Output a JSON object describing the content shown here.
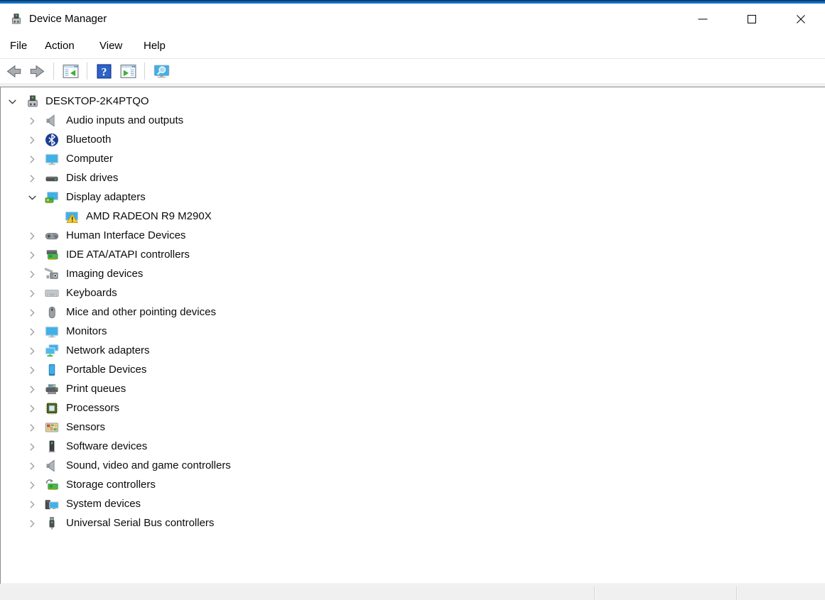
{
  "window": {
    "title": "Device Manager",
    "icon": "device-manager",
    "controls": [
      {
        "name": "minimize",
        "glyph": "minimize"
      },
      {
        "name": "maximize",
        "glyph": "maximize"
      },
      {
        "name": "close",
        "glyph": "close"
      }
    ]
  },
  "menu": {
    "items": [
      {
        "label": "File"
      },
      {
        "label": "Action"
      },
      {
        "label": "View"
      },
      {
        "label": "Help"
      }
    ]
  },
  "toolbar": {
    "buttons": [
      {
        "name": "back",
        "icon": "back-arrow"
      },
      {
        "name": "forward",
        "icon": "forward-arrow"
      },
      {
        "name": "separator"
      },
      {
        "name": "show-console-tree",
        "icon": "console-tree"
      },
      {
        "name": "separator"
      },
      {
        "name": "help",
        "icon": "help"
      },
      {
        "name": "show-action-pane",
        "icon": "action-pane"
      },
      {
        "name": "separator"
      },
      {
        "name": "scan-for-hardware-changes",
        "icon": "scan-hardware"
      }
    ]
  },
  "tree": {
    "items": [
      {
        "label": "DESKTOP-2K4PTQO",
        "icon": "device-manager",
        "level": 0,
        "expanded": true,
        "has_children": true
      },
      {
        "label": "Audio inputs and outputs",
        "icon": "audio",
        "level": 1,
        "expanded": false,
        "has_children": true
      },
      {
        "label": "Bluetooth",
        "icon": "bluetooth",
        "level": 1,
        "expanded": false,
        "has_children": true
      },
      {
        "label": "Computer",
        "icon": "computer",
        "level": 1,
        "expanded": false,
        "has_children": true
      },
      {
        "label": "Disk drives",
        "icon": "disk",
        "level": 1,
        "expanded": false,
        "has_children": true
      },
      {
        "label": "Display adapters",
        "icon": "display-adapter",
        "level": 1,
        "expanded": true,
        "has_children": true
      },
      {
        "label": "AMD RADEON R9 M290X",
        "icon": "display-warning",
        "level": 2,
        "expanded": false,
        "has_children": false,
        "status": "warning"
      },
      {
        "label": "Human Interface Devices",
        "icon": "hid",
        "level": 1,
        "expanded": false,
        "has_children": true
      },
      {
        "label": "IDE ATA/ATAPI controllers",
        "icon": "ide",
        "level": 1,
        "expanded": false,
        "has_children": true
      },
      {
        "label": "Imaging devices",
        "icon": "imaging",
        "level": 1,
        "expanded": false,
        "has_children": true
      },
      {
        "label": "Keyboards",
        "icon": "keyboard",
        "level": 1,
        "expanded": false,
        "has_children": true
      },
      {
        "label": "Mice and other pointing devices",
        "icon": "mouse",
        "level": 1,
        "expanded": false,
        "has_children": true
      },
      {
        "label": "Monitors",
        "icon": "monitor",
        "level": 1,
        "expanded": false,
        "has_children": true
      },
      {
        "label": "Network adapters",
        "icon": "network",
        "level": 1,
        "expanded": false,
        "has_children": true
      },
      {
        "label": "Portable Devices",
        "icon": "portable",
        "level": 1,
        "expanded": false,
        "has_children": true
      },
      {
        "label": "Print queues",
        "icon": "printer",
        "level": 1,
        "expanded": false,
        "has_children": true
      },
      {
        "label": "Processors",
        "icon": "processor",
        "level": 1,
        "expanded": false,
        "has_children": true
      },
      {
        "label": "Sensors",
        "icon": "sensors",
        "level": 1,
        "expanded": false,
        "has_children": true
      },
      {
        "label": "Software devices",
        "icon": "software",
        "level": 1,
        "expanded": false,
        "has_children": true
      },
      {
        "label": "Sound, video and game controllers",
        "icon": "sound",
        "level": 1,
        "expanded": false,
        "has_children": true
      },
      {
        "label": "Storage controllers",
        "icon": "storage",
        "level": 1,
        "expanded": false,
        "has_children": true
      },
      {
        "label": "System devices",
        "icon": "system",
        "level": 1,
        "expanded": false,
        "has_children": true
      },
      {
        "label": "Universal Serial Bus controllers",
        "icon": "usb",
        "level": 1,
        "expanded": false,
        "has_children": true
      }
    ]
  },
  "colors": {
    "accent_blue": "#1271c8",
    "warning_yellow": "#f7cb2d",
    "device_blue": "#3fb0e8",
    "card_green": "#49b74f",
    "statusbar_gray": "#f0f0f0"
  }
}
